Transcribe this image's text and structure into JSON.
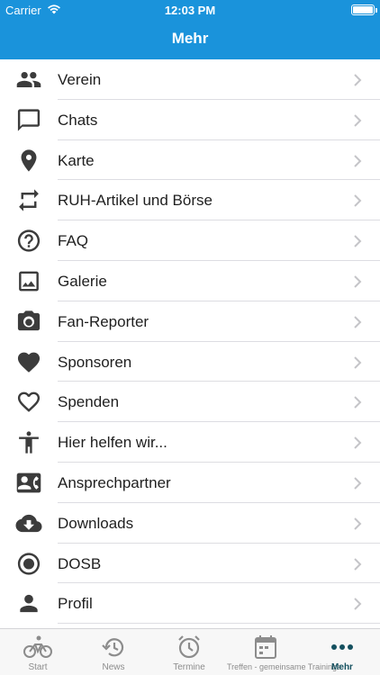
{
  "status_bar": {
    "carrier": "Carrier",
    "time": "12:03 PM"
  },
  "header": {
    "title": "Mehr",
    "background": "#1a93db"
  },
  "menu": [
    {
      "label": "Verein",
      "icon": "people-icon"
    },
    {
      "label": "Chats",
      "icon": "chat-bubble-icon"
    },
    {
      "label": "Karte",
      "icon": "map-pin-icon"
    },
    {
      "label": "RUH-Artikel und Börse",
      "icon": "repeat-icon"
    },
    {
      "label": "FAQ",
      "icon": "help-circle-icon"
    },
    {
      "label": "Galerie",
      "icon": "image-icon"
    },
    {
      "label": "Fan-Reporter",
      "icon": "camera-icon"
    },
    {
      "label": "Sponsoren",
      "icon": "heart-filled-icon"
    },
    {
      "label": "Spenden",
      "icon": "heart-outline-icon"
    },
    {
      "label": "Hier helfen wir...",
      "icon": "accessibility-icon"
    },
    {
      "label": "Ansprechpartner",
      "icon": "contact-card-icon"
    },
    {
      "label": "Downloads",
      "icon": "cloud-download-icon"
    },
    {
      "label": "DOSB",
      "icon": "radio-button-icon"
    },
    {
      "label": "Profil",
      "icon": "person-icon"
    }
  ],
  "tabs": [
    {
      "label": "Start",
      "icon": "bicycle-icon",
      "active": false
    },
    {
      "label": "News",
      "icon": "history-icon",
      "active": false
    },
    {
      "label": "Termine",
      "icon": "alarm-clock-icon",
      "active": false
    },
    {
      "label": "Treffen - gemeinsame Trainings",
      "icon": "calendar-icon",
      "active": false
    },
    {
      "label": "Mehr",
      "icon": "more-dots-icon",
      "active": true
    }
  ],
  "colors": {
    "icon": "#3c3c3c",
    "chevron": "#c4c4c8",
    "active_tab": "#14505f",
    "inactive_tab": "#8c8c8c"
  }
}
